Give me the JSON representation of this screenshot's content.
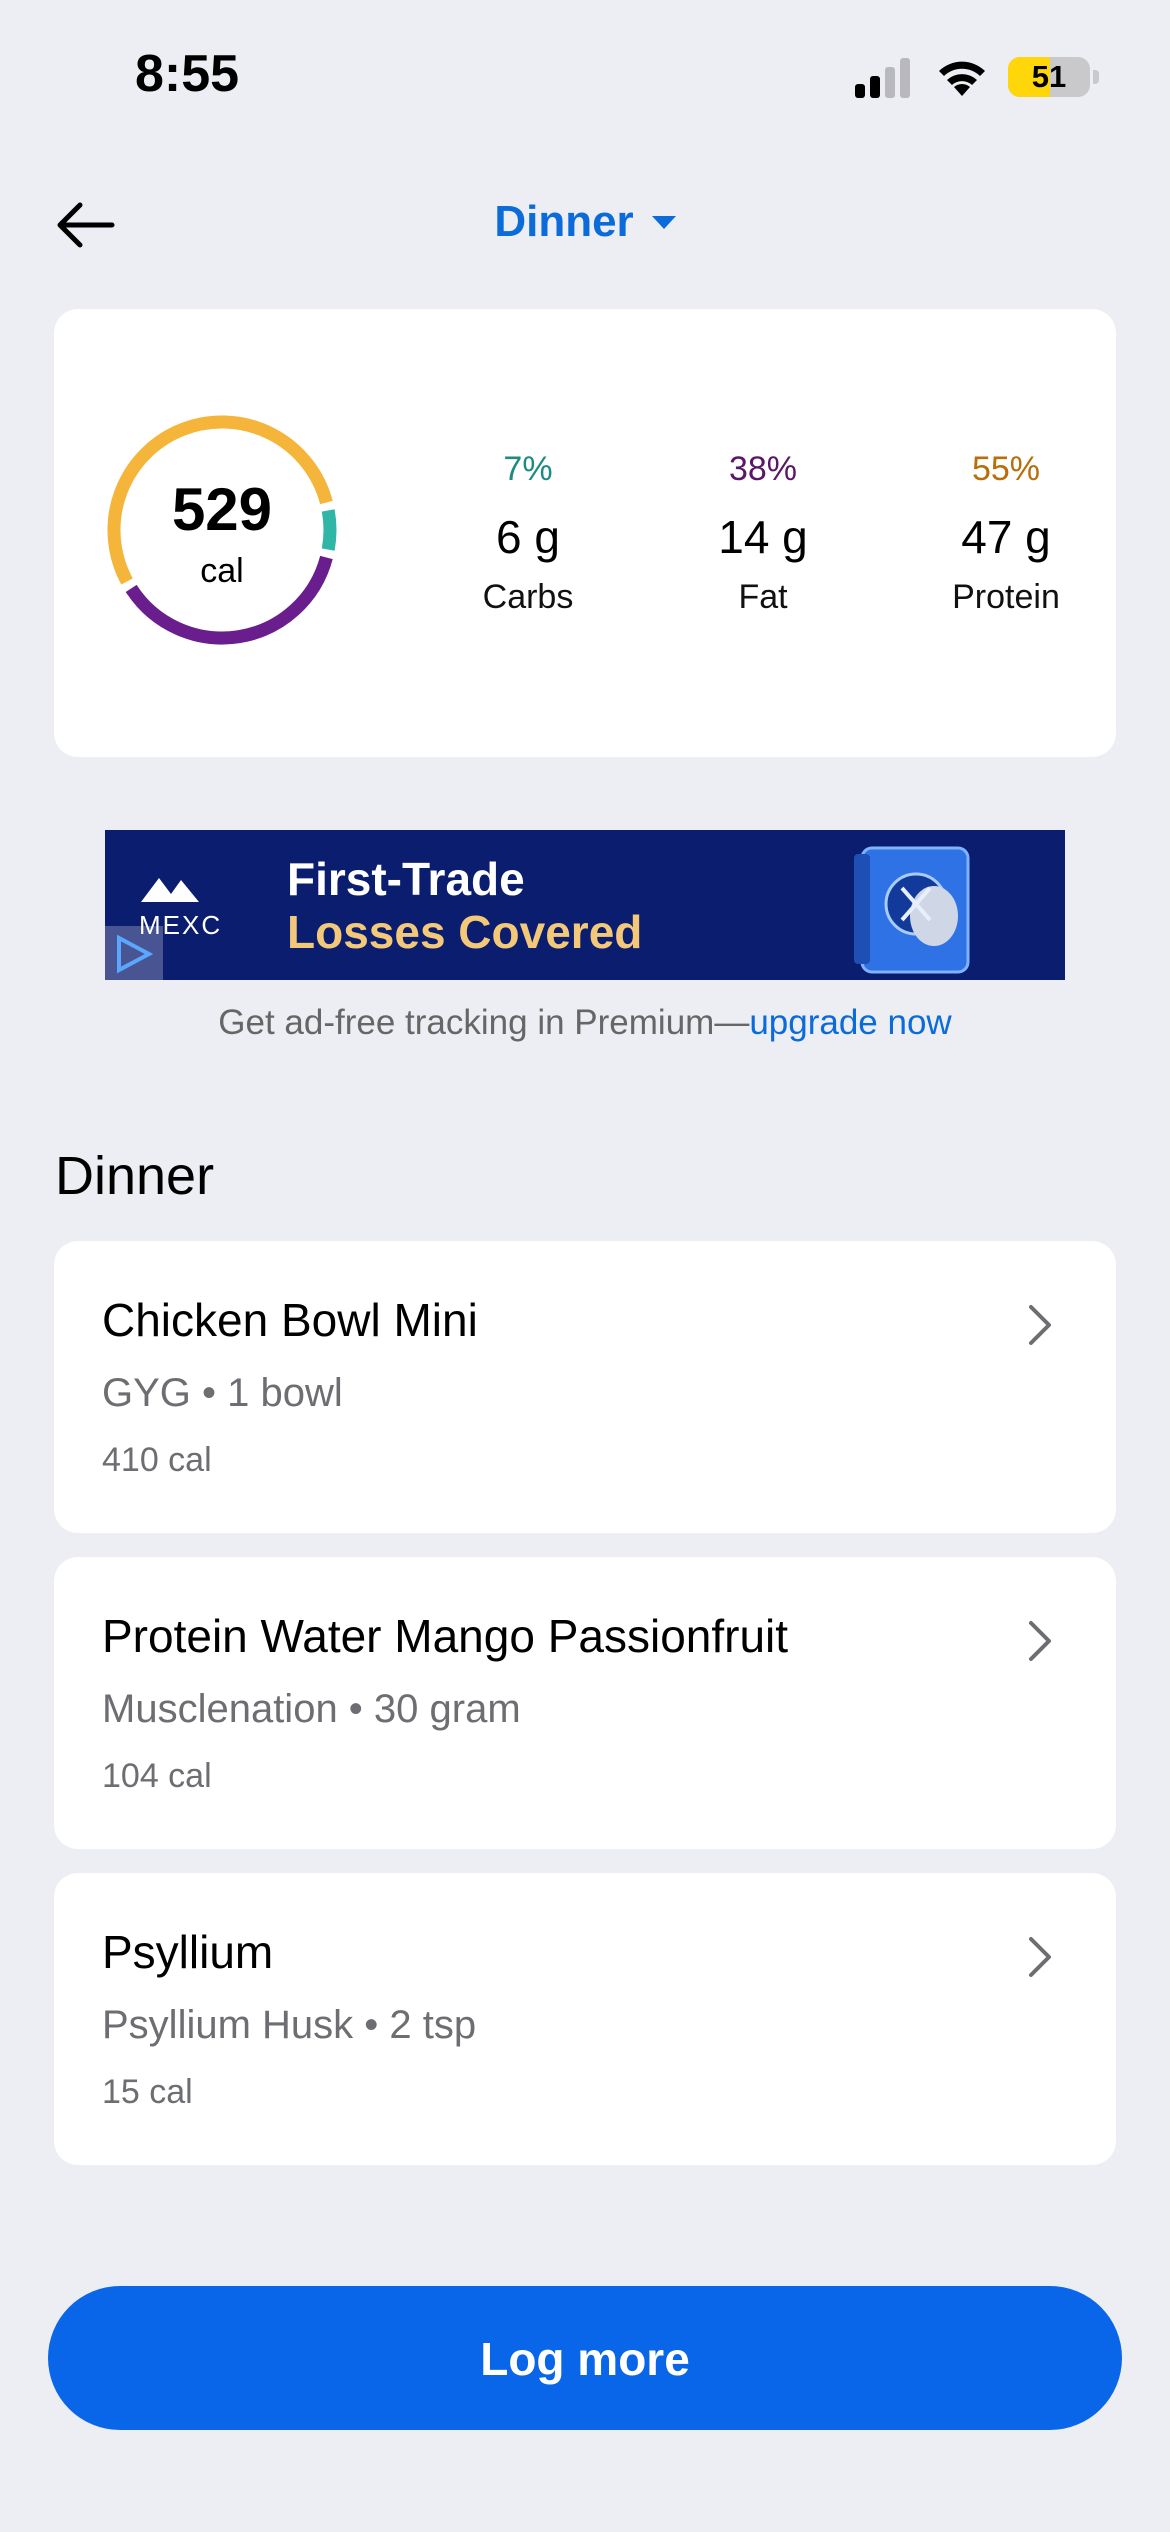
{
  "status_bar": {
    "time": "8:55",
    "battery": "51",
    "battery_level": 0.51
  },
  "header": {
    "meal": "Dinner"
  },
  "summary": {
    "calories": "529",
    "calories_unit": "cal",
    "ring_colors": {
      "carbs": "#2fb6a7",
      "fat": "#6a1d8c",
      "protein": "#f5b43a"
    },
    "macros": [
      {
        "pct": "7%",
        "grams": "6 g",
        "name": "Carbs",
        "color": "#1f8a7f",
        "fraction": 0.07
      },
      {
        "pct": "38%",
        "grams": "14 g",
        "name": "Fat",
        "color": "#5b1767",
        "fraction": 0.38
      },
      {
        "pct": "55%",
        "grams": "47 g",
        "name": "Protein",
        "color": "#b86e0a",
        "fraction": 0.55
      }
    ]
  },
  "ad": {
    "brand": "MEXC",
    "line1": "First-Trade",
    "line2": "Losses Covered",
    "note_prefix": "Get ad-free tracking in Premium—",
    "note_link": "upgrade now"
  },
  "section": {
    "title": "Dinner"
  },
  "foods": [
    {
      "name": "Chicken Bowl Mini",
      "detail": "GYG • 1 bowl",
      "calories": "410 cal"
    },
    {
      "name": "Protein Water Mango Passionfruit",
      "detail": "Musclenation • 30 gram",
      "calories": "104 cal"
    },
    {
      "name": "Psyllium",
      "detail": "Psyllium Husk • 2 tsp",
      "calories": "15 cal"
    }
  ],
  "actions": {
    "log_more": "Log more"
  }
}
